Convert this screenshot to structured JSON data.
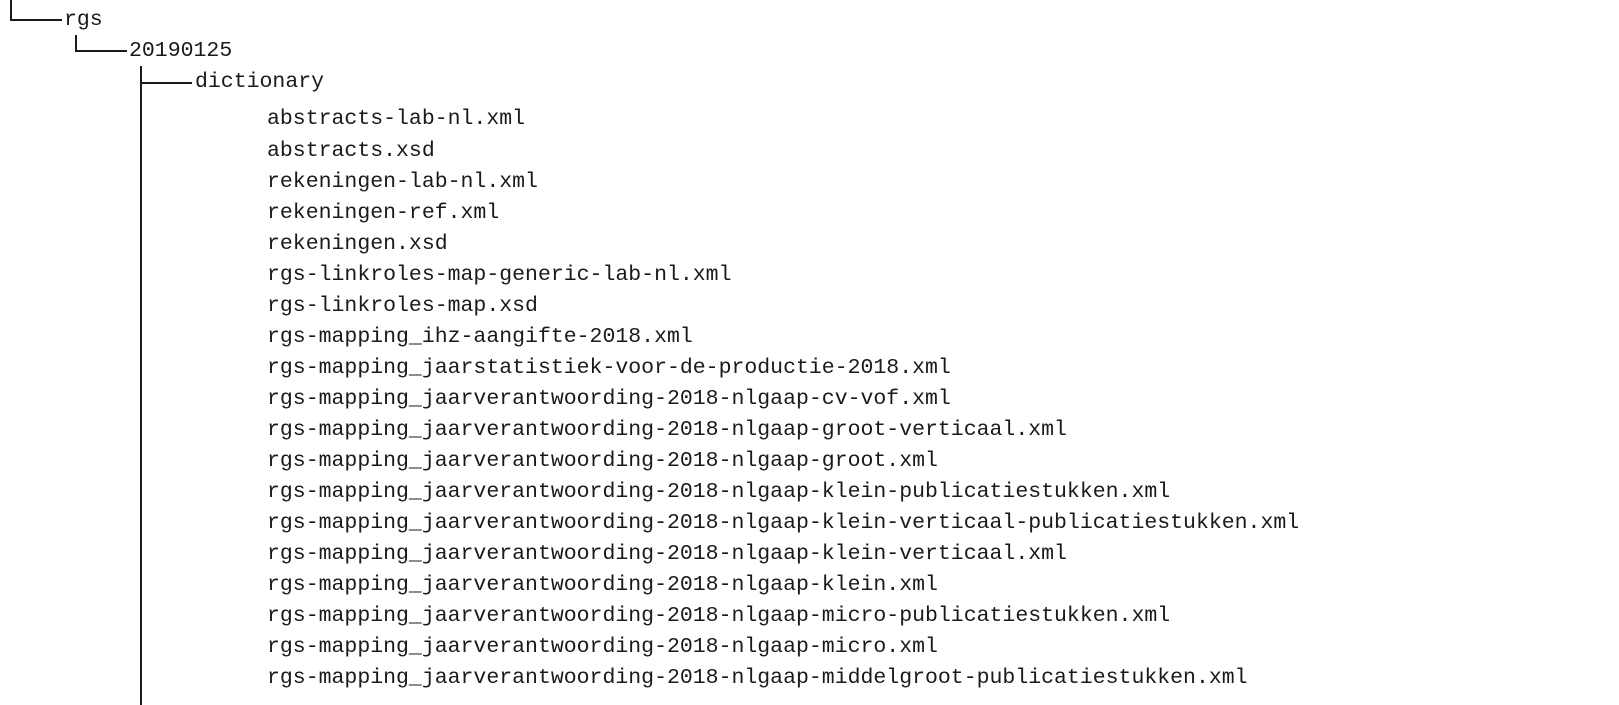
{
  "tree": {
    "root": "rgs",
    "version": "20190125",
    "folder": "dictionary",
    "files": [
      "abstracts-lab-nl.xml",
      "abstracts.xsd",
      "rekeningen-lab-nl.xml",
      "rekeningen-ref.xml",
      "rekeningen.xsd",
      "rgs-linkroles-map-generic-lab-nl.xml",
      "rgs-linkroles-map.xsd",
      "rgs-mapping_ihz-aangifte-2018.xml",
      "rgs-mapping_jaarstatistiek-voor-de-productie-2018.xml",
      "rgs-mapping_jaarverantwoording-2018-nlgaap-cv-vof.xml",
      "rgs-mapping_jaarverantwoording-2018-nlgaap-groot-verticaal.xml",
      "rgs-mapping_jaarverantwoording-2018-nlgaap-groot.xml",
      "rgs-mapping_jaarverantwoording-2018-nlgaap-klein-publicatiestukken.xml",
      "rgs-mapping_jaarverantwoording-2018-nlgaap-klein-verticaal-publicatiestukken.xml",
      "rgs-mapping_jaarverantwoording-2018-nlgaap-klein-verticaal.xml",
      "rgs-mapping_jaarverantwoording-2018-nlgaap-klein.xml",
      "rgs-mapping_jaarverantwoording-2018-nlgaap-micro-publicatiestukken.xml",
      "rgs-mapping_jaarverantwoording-2018-nlgaap-micro.xml",
      "rgs-mapping_jaarverantwoording-2018-nlgaap-middelgroot-publicatiestukken.xml"
    ]
  }
}
